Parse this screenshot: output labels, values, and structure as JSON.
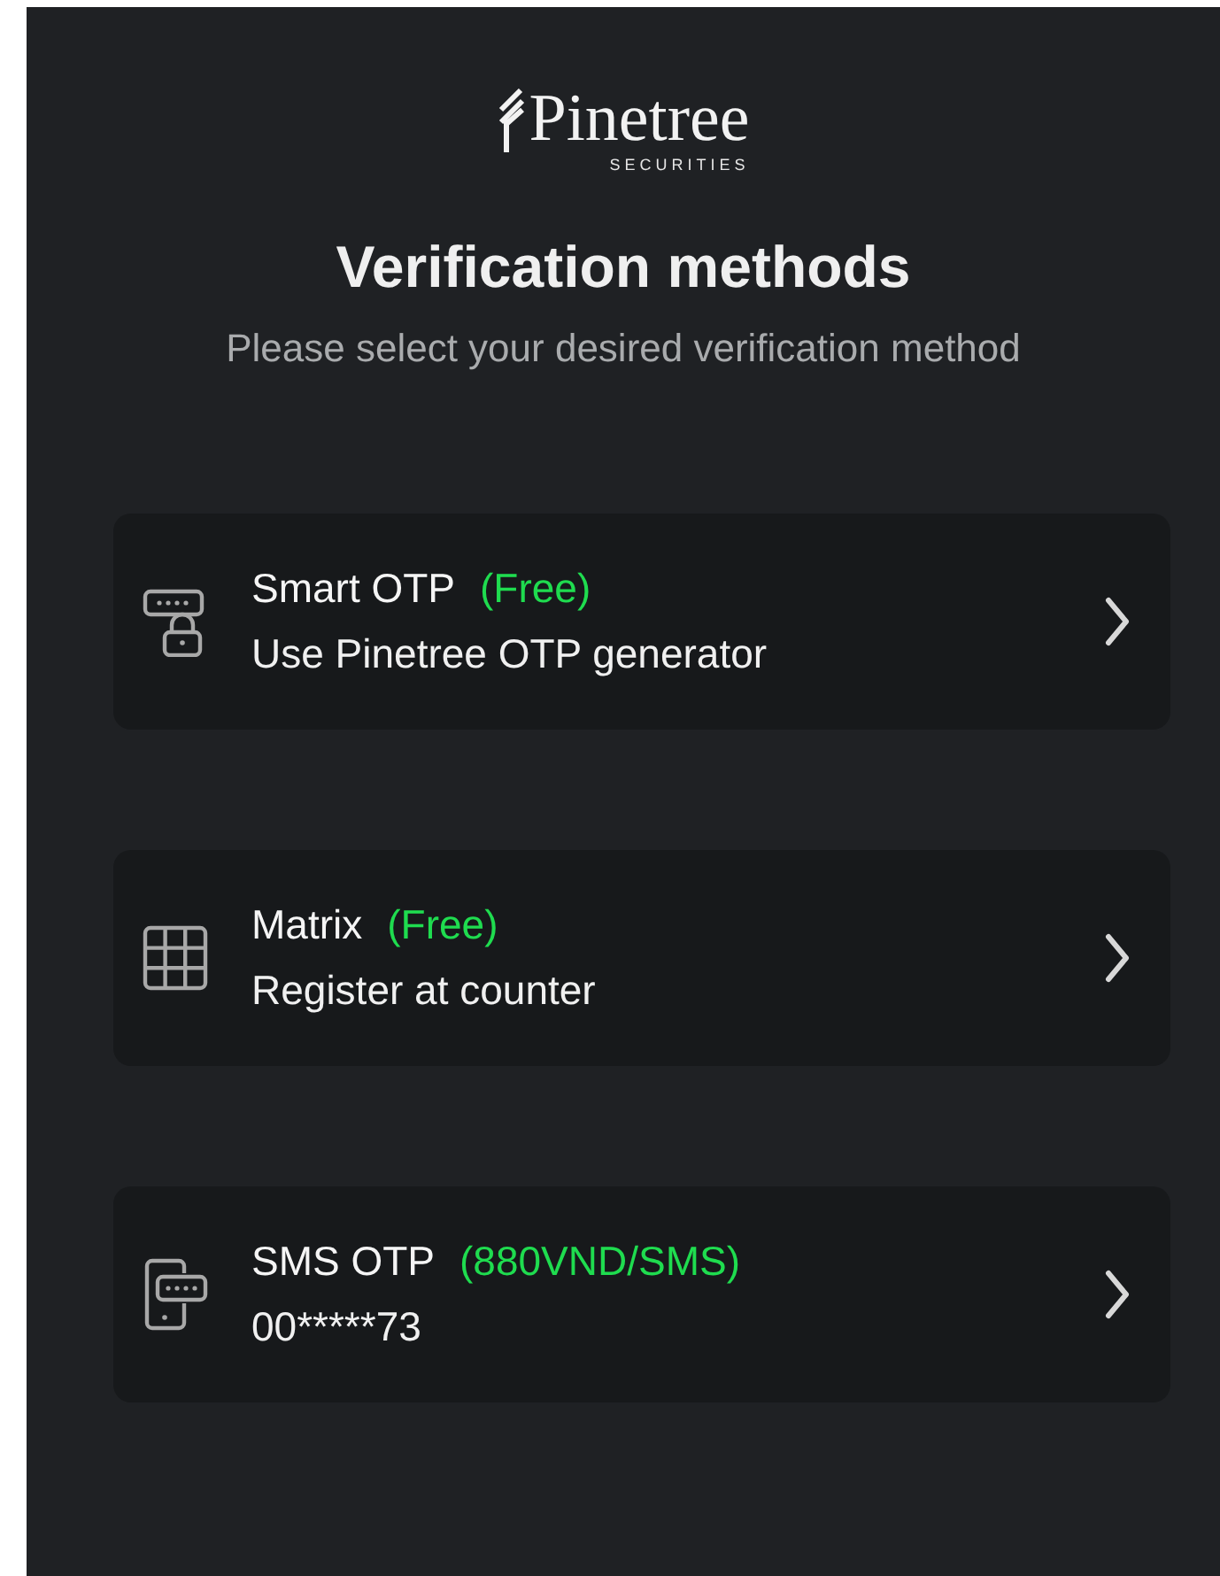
{
  "logo": {
    "name": "Pinetree",
    "tagline": "SECURITIES"
  },
  "title": "Verification methods",
  "subtitle": "Please select your desired verification method",
  "methods": [
    {
      "kind": "otp",
      "name": "Smart OTP",
      "price": "(Free)",
      "detail": "Use Pinetree OTP generator"
    },
    {
      "kind": "matrix",
      "name": "Matrix",
      "price": "(Free)",
      "detail": "Register at counter"
    },
    {
      "kind": "sms",
      "name": "SMS OTP",
      "price": "(880VND/SMS)",
      "detail": "00*****73"
    }
  ]
}
